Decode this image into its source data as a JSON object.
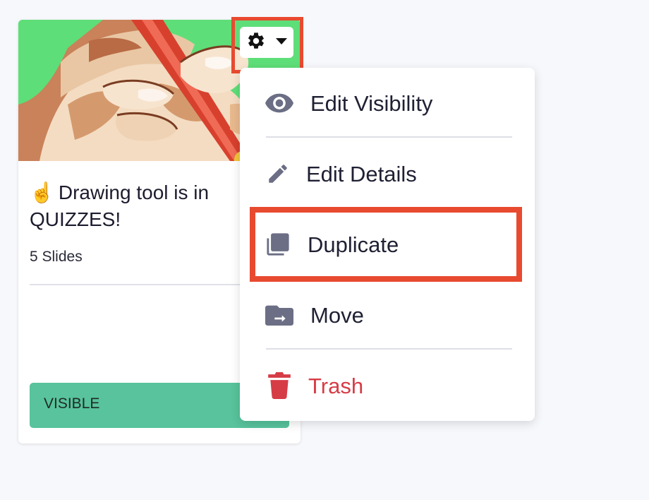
{
  "card": {
    "emoji": "☝️",
    "title": "Drawing tool is in QUIZZES!",
    "slide_count": "5 Slides",
    "visibility_badge": "VISIBLE"
  },
  "gear_button": {
    "icon": "gear-icon",
    "caret": "caret-down-icon"
  },
  "menu": {
    "items": [
      {
        "label": "Edit Visibility",
        "icon": "eye-icon"
      },
      {
        "label": "Edit Details",
        "icon": "pencil-icon"
      },
      {
        "label": "Duplicate",
        "icon": "duplicate-icon"
      },
      {
        "label": "Move",
        "icon": "folder-move-icon"
      },
      {
        "label": "Trash",
        "icon": "trash-icon"
      }
    ]
  },
  "colors": {
    "background": "#f7f8fc",
    "badge_green": "#58c39c",
    "highlight_red": "#e84a30",
    "trash_red": "#d63c46",
    "icon_gray": "#6b6e84",
    "thumbnail_green": "#5ede78"
  }
}
